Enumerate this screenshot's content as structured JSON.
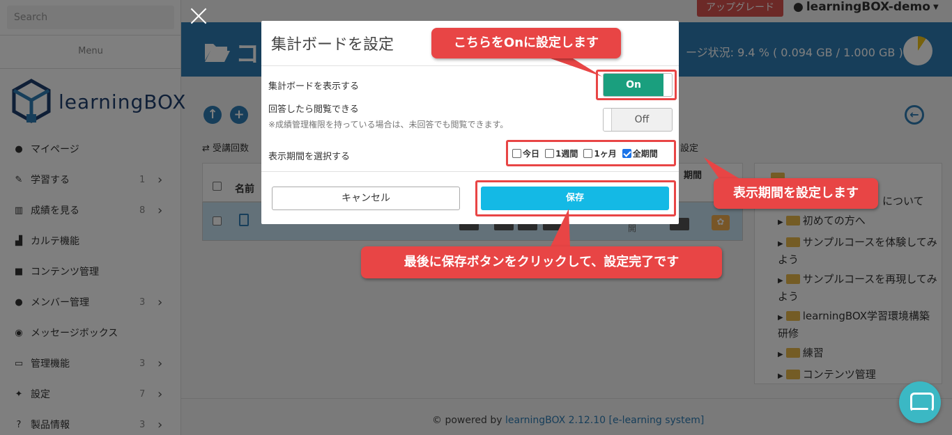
{
  "sidebar": {
    "search_placeholder": "Search",
    "menu_label": "Menu",
    "logo_text": "learningBOX",
    "items": [
      {
        "label": "マイページ",
        "count": "",
        "chevron": false
      },
      {
        "label": "学習する",
        "count": "1",
        "chevron": true
      },
      {
        "label": "成績を見る",
        "count": "8",
        "chevron": true
      },
      {
        "label": "カルテ機能",
        "count": "",
        "chevron": false
      },
      {
        "label": "コンテンツ管理",
        "count": "",
        "chevron": false
      },
      {
        "label": "メンバー管理",
        "count": "3",
        "chevron": true
      },
      {
        "label": "メッセージボックス",
        "count": "",
        "chevron": false
      },
      {
        "label": "管理機能",
        "count": "3",
        "chevron": true
      },
      {
        "label": "設定",
        "count": "7",
        "chevron": true
      },
      {
        "label": "製品情報",
        "count": "3",
        "chevron": true
      }
    ]
  },
  "topbar": {
    "upgrade_label": "アップグレード",
    "user_label": "learningBOX-demo"
  },
  "header": {
    "folder_title": "コ",
    "storage_text": "ージ状況: 9.4 % ( 0.094 GB / 1.000 GB )",
    "storage_fraction": 0.094
  },
  "content": {
    "info_left": "受講回数",
    "info_right": "設定",
    "col_name": "名前",
    "col_extra": "期間",
    "row_text": "開"
  },
  "tree": {
    "first_suffix": "について",
    "items": [
      "初めての方へ",
      "サンプルコースを体験してみよう",
      "サンプルコースを再現してみよう",
      "learningBOX学習環境構築研修",
      "練習",
      "コンテンツ管理"
    ]
  },
  "footer": {
    "prefix": "© powered by",
    "link": "learningBOX 2.12.10 [e-learning system]"
  },
  "modal": {
    "title": "集計ボードを設定",
    "show_board_label": "集計ボードを表示する",
    "show_board_toggle": "On",
    "view_after_answer_label": "回答したら閲覧できる",
    "view_after_answer_note": "※成績管理権限を持っている場合は、未回答でも閲覧できます。",
    "view_after_answer_toggle": "Off",
    "period_label": "表示期間を選択する",
    "period_options": [
      {
        "label": "今日",
        "checked": false
      },
      {
        "label": "1週間",
        "checked": false
      },
      {
        "label": "1ヶ月",
        "checked": false
      },
      {
        "label": "全期間",
        "checked": true
      }
    ],
    "cancel_label": "キャンセル",
    "save_label": "保存"
  },
  "annotations": {
    "callout_on": "こちらをOnに設定します",
    "callout_period": "表示期間を設定します",
    "callout_save": "最後に保存ボタンをクリックして、設定完了です",
    "color": "#e84545"
  }
}
